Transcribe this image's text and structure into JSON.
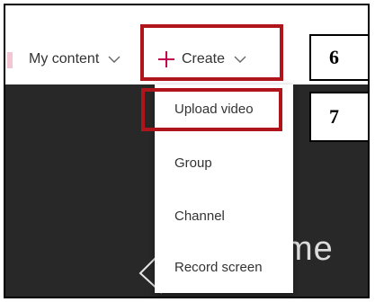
{
  "nav": {
    "my_content_label": "My content",
    "create_label": "Create"
  },
  "create_menu": {
    "items": [
      "Upload video",
      "Group",
      "Channel",
      "Record screen"
    ]
  },
  "callouts": {
    "create_step": "6",
    "upload_step": "7"
  },
  "hero": {
    "text_fragment": "me"
  },
  "icons": {
    "create": "plus-icon",
    "dropdown": "chevron-down-icon",
    "search": "search-icon",
    "carousel_prev": "chevron-left-icon"
  },
  "colors": {
    "accent": "#c30052",
    "highlight": "#b0151c",
    "dark_background": "#282828"
  }
}
